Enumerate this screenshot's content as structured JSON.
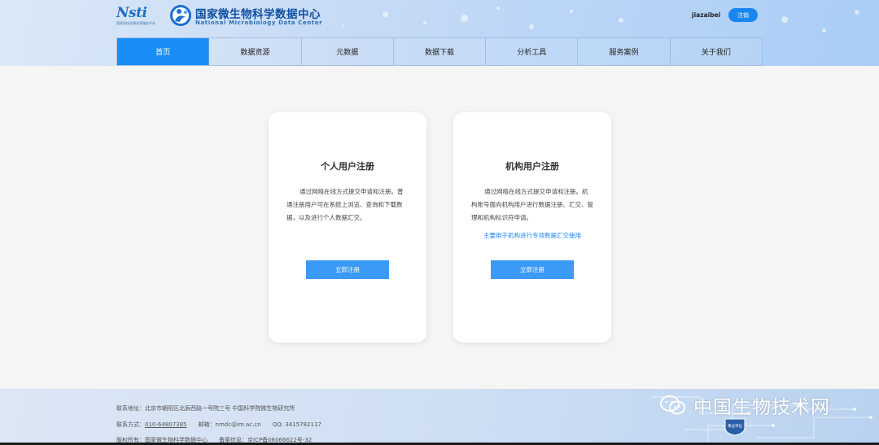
{
  "header": {
    "logo_nsti_text": "Nsti",
    "logo_nsti_sub": "国家科技资源共享服务平台",
    "brand_title": "国家微生物科学数据中心",
    "brand_subtitle": "National Microbiology Data Center",
    "username": "jiazaibei",
    "logout_label": "注销"
  },
  "nav": {
    "items": [
      {
        "label": "首页",
        "active": true
      },
      {
        "label": "数据资源",
        "active": false
      },
      {
        "label": "元数据",
        "active": false
      },
      {
        "label": "数据下载",
        "active": false
      },
      {
        "label": "分析工具",
        "active": false
      },
      {
        "label": "服务案例",
        "active": false
      },
      {
        "label": "关于我们",
        "active": false
      }
    ]
  },
  "cards": {
    "personal": {
      "title": "个人用户注册",
      "description": "通过网络在线方式提交申请和注册。普通注册用户可在系统上浏览、查询和下载数据，以及进行个人数据汇交。",
      "button": "立即注册"
    },
    "org": {
      "title": "机构用户注册",
      "description": "通过网络在线方式提交申请和注册。机构账号面向机构用户进行数据注册、汇交、管理和机构标识符申请。",
      "note": "主要用于机构进行专项数据汇交使用",
      "button": "立即注册"
    }
  },
  "footer": {
    "address_label": "联系地址：",
    "address": "北京市朝阳区北辰西路一号院三号 中国科学院微生物研究所",
    "contact_label": "联系方式：",
    "phone": "010-64807385",
    "email_label": "邮箱：",
    "email": "nmdc@im.ac.cn",
    "qq_label": "QQ:",
    "qq": "3415782117",
    "copyright_label": "版权所有：",
    "copyright": "国家微生物科学数据中心",
    "icp_label": "备案信息：",
    "icp": "京ICP备06066622号-32"
  },
  "watermark": {
    "text": "中国生物技术网",
    "badge_text": "事业单位"
  },
  "colors": {
    "accent": "#1a8cf5",
    "button": "#3a9af5",
    "link": "#1a86f0",
    "page_bg": "#f5f5f5"
  }
}
